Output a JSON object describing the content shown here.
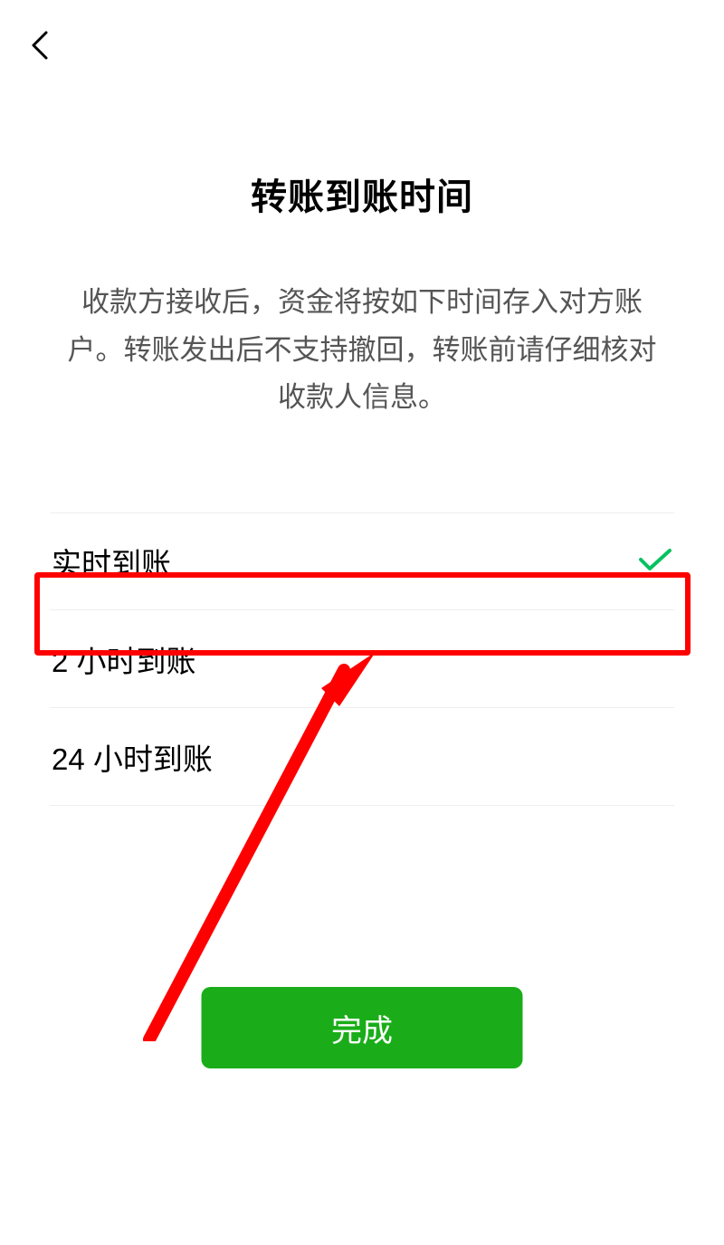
{
  "header": {
    "back_label": "返回"
  },
  "page": {
    "title": "转账到账时间",
    "description": "收款方接收后，资金将按如下时间存入对方账户。转账发出后不支持撤回，转账前请仔细核对收款人信息。"
  },
  "options": [
    {
      "label": "实时到账",
      "selected": true
    },
    {
      "label": "2 小时到账",
      "selected": false
    },
    {
      "label": "24 小时到账",
      "selected": false
    }
  ],
  "button": {
    "confirm_label": "完成"
  },
  "colors": {
    "accent": "#1aad19",
    "check": "#07c160",
    "annotation": "#ff0000"
  }
}
